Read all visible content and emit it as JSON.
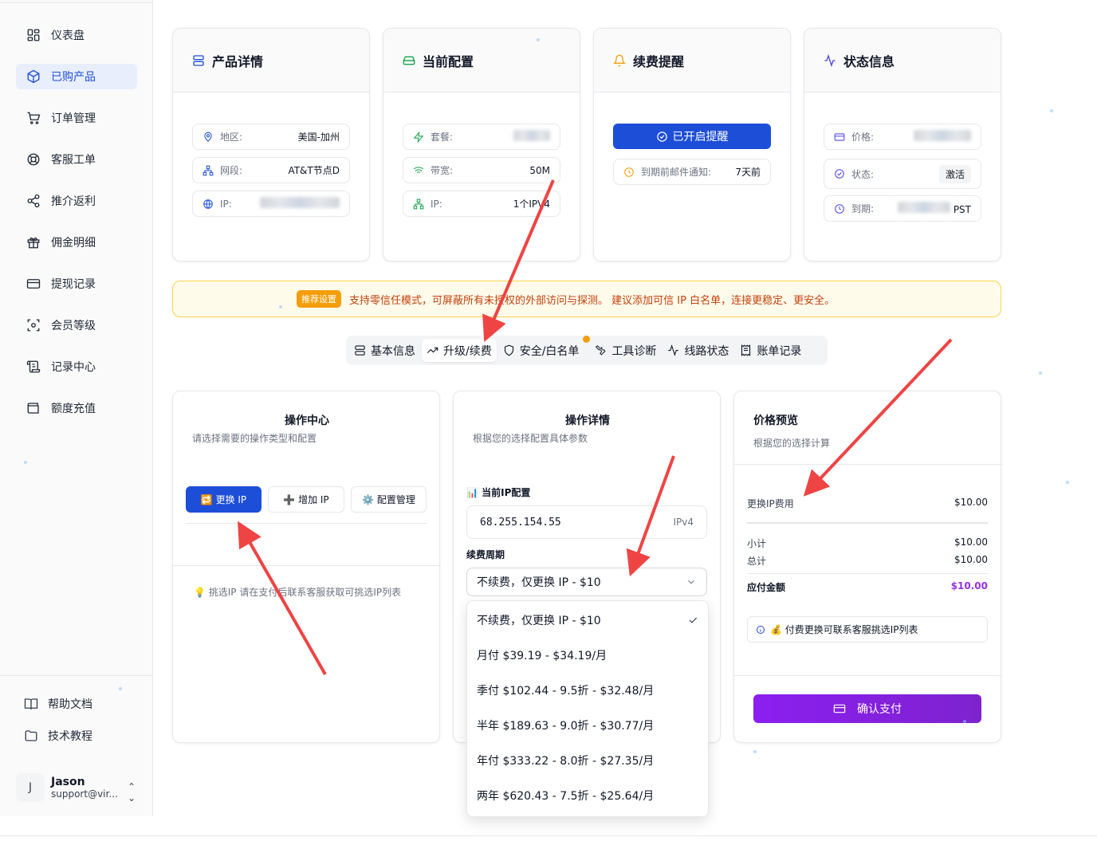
{
  "sidebar": {
    "items": [
      {
        "label": "仪表盘",
        "icon": "dashboard-icon",
        "active": false
      },
      {
        "label": "已购产品",
        "icon": "package-icon",
        "active": true
      },
      {
        "label": "订单管理",
        "icon": "cart-icon",
        "active": false
      },
      {
        "label": "客服工单",
        "icon": "lifebuoy-icon",
        "active": false
      },
      {
        "label": "推介返利",
        "icon": "share-icon",
        "active": false
      },
      {
        "label": "佣金明细",
        "icon": "gift-icon",
        "active": false
      },
      {
        "label": "提现记录",
        "icon": "card-icon",
        "active": false
      },
      {
        "label": "会员等级",
        "icon": "scan-icon",
        "active": false
      },
      {
        "label": "记录中心",
        "icon": "scroll-icon",
        "active": false
      },
      {
        "label": "额度充值",
        "icon": "wallet-icon",
        "active": false
      }
    ],
    "footer_items": [
      {
        "label": "帮助文档",
        "icon": "book-icon"
      },
      {
        "label": "技术教程",
        "icon": "folder-icon"
      }
    ],
    "user": {
      "initial": "J",
      "name": "Jason",
      "email": "support@vir..."
    }
  },
  "product_card": {
    "title": "产品详情",
    "fields": [
      {
        "label": "地区:",
        "value": "美国-加州"
      },
      {
        "label": "网段:",
        "value": "AT&T节点D"
      },
      {
        "label": "IP:",
        "value": ""
      }
    ]
  },
  "config_card": {
    "title": "当前配置",
    "fields": [
      {
        "label": "套餐:",
        "value": ""
      },
      {
        "label": "带宽:",
        "value": "50M"
      },
      {
        "label": "IP:",
        "value": "1个IPV4"
      }
    ]
  },
  "renew_card": {
    "title": "续费提醒",
    "button": "已开启提醒",
    "field": {
      "label": "到期前邮件通知:",
      "value": "7天前"
    }
  },
  "status_card": {
    "title": "状态信息",
    "fields": [
      {
        "label": "价格:",
        "value": ""
      },
      {
        "label": "状态:",
        "value": "激活"
      },
      {
        "label": "到期:",
        "value": "PST"
      }
    ]
  },
  "banner": {
    "badge": "推荐设置",
    "text": "支持零信任模式，可屏蔽所有未授权的外部访问与探测。 建议添加可信 IP 白名单，连接更稳定、更安全。"
  },
  "tabs": [
    {
      "label": "基本信息",
      "icon": "server-icon",
      "active": false
    },
    {
      "label": "升级/续费",
      "icon": "trend-up-icon",
      "active": true
    },
    {
      "label": "安全/白名单",
      "icon": "shield-icon",
      "active": false,
      "dot": true
    },
    {
      "label": "工具诊断",
      "icon": "wrench-icon",
      "active": false
    },
    {
      "label": "线路状态",
      "icon": "activity-icon",
      "active": false
    },
    {
      "label": "账单记录",
      "icon": "receipt-icon",
      "active": false
    }
  ],
  "ops_card": {
    "title": "操作中心",
    "subtitle": "请选择需要的操作类型和配置",
    "buttons": [
      "🔁 更换 IP",
      "➕ 增加 IP",
      "⚙️ 配置管理"
    ],
    "hint": "💡 挑选IP 请在支付后联系客服获取可挑选IP列表"
  },
  "details_card": {
    "title": "操作详情",
    "subtitle": "根据您的选择配置具体参数",
    "current_ip_label": "📊 当前IP配置",
    "current_ip": "68.255.154.55",
    "ip_type": "IPv4",
    "period_label": "续费周期",
    "selected": "不续费，仅更换 IP - $10",
    "options": [
      "不续费，仅更换 IP - $10",
      "月付 $39.19 - $34.19/月",
      "季付 $102.44 - 9.5折 - $32.48/月",
      "半年 $189.63 - 9.0折 - $30.77/月",
      "年付 $333.22 - 8.0折 - $27.35/月",
      "两年 $620.43 - 7.5折 - $25.64/月"
    ]
  },
  "price_card": {
    "title": "价格预览",
    "subtitle": "根据您的选择计算",
    "fee_label": "更换IP费用",
    "fee_value": "$10.00",
    "subtotal_label": "小计",
    "subtotal_value": "$10.00",
    "total_label": "总计",
    "total_value": "$10.00",
    "due_label": "应付金额",
    "due_value": "$10.00",
    "info": "💰 付费更换可联系客服挑选IP列表",
    "pay_button": "确认支付"
  },
  "colors": {
    "primary": "#1d4ed8",
    "purple": "#7e22ce",
    "annotation_arrow": "#ef4444",
    "warning": "#f59e0b"
  }
}
